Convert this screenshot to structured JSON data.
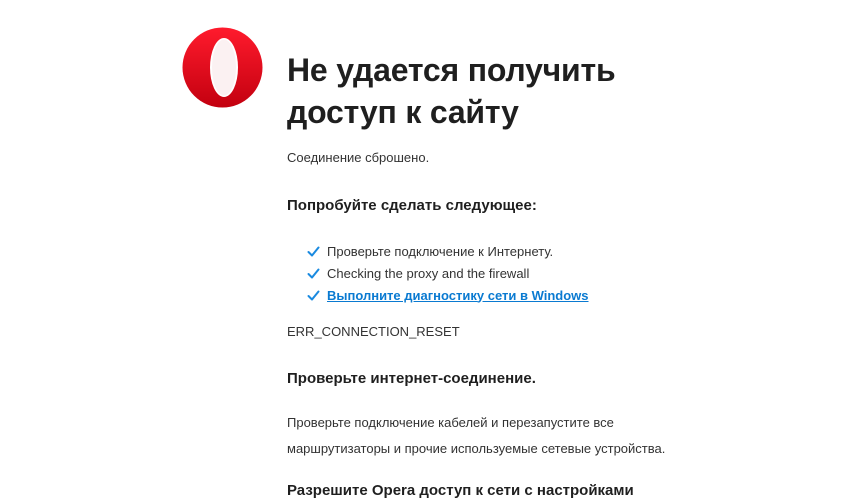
{
  "page": {
    "logo_icon": "opera-logo-icon",
    "title": "Не удается получить доступ к сайту",
    "subtitle": "Соединение сброшено.",
    "suggestions_heading": "Попробуйте сделать следующее:",
    "suggestions": [
      {
        "text": "Проверьте подключение к Интернету.",
        "icon": "check-icon"
      },
      {
        "text": "Checking the proxy and the firewall",
        "icon": "check-icon"
      },
      {
        "text": "Выполните диагностику сети в Windows",
        "icon": "check-icon",
        "link": true
      }
    ],
    "error_code": "ERR_CONNECTION_RESET",
    "connection_heading": "Проверьте интернет-соединение.",
    "connection_text": "Проверьте подключение кабелей и перезапустите все маршрутизаторы и прочие используемые сетевые устройства.",
    "access_heading": "Разрешите Opera доступ к сети с настройками"
  },
  "colors": {
    "brand_red": "#e0142a",
    "link_blue": "#0a7ad1",
    "check_blue": "#1a8ae0",
    "text": "#1f1f1f"
  }
}
